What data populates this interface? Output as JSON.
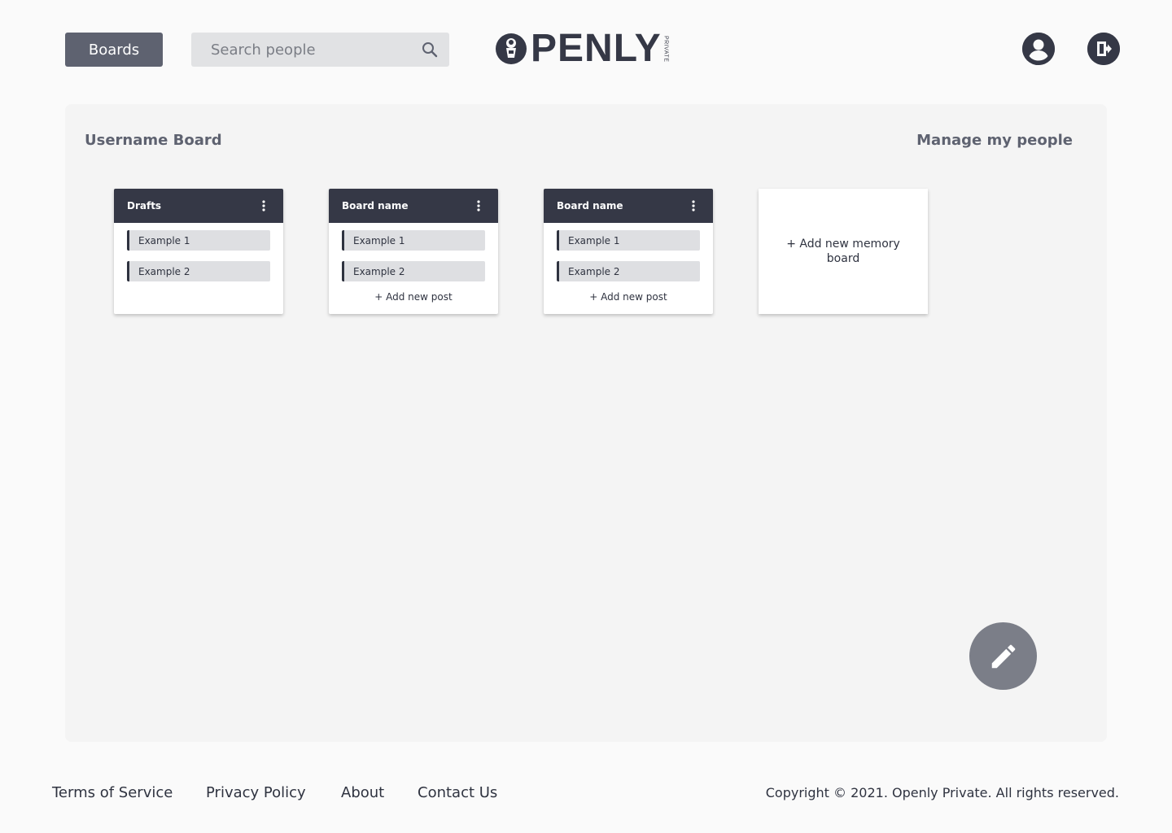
{
  "header": {
    "boards_label": "Boards",
    "search_placeholder": "Search people",
    "logo_text": "PENLY",
    "logo_sub": "PRIVATE",
    "icons": {
      "search": "search-icon",
      "profile": "account-circle-icon",
      "logout": "logout-icon"
    }
  },
  "board": {
    "title": "Username Board",
    "manage_label": "Manage my people",
    "cards": [
      {
        "title": "Drafts",
        "posts": [
          "Example 1",
          "Example 2"
        ],
        "add_label": ""
      },
      {
        "title": "Board name",
        "posts": [
          "Example 1",
          "Example 2"
        ],
        "add_label": "+ Add new post"
      },
      {
        "title": "Board name",
        "posts": [
          "Example 1",
          "Example 2"
        ],
        "add_label": "+ Add new post"
      }
    ],
    "add_board_label": "+ Add new memory board"
  },
  "footer": {
    "links": [
      "Terms of Service",
      "Privacy Policy",
      "About",
      "Contact Us"
    ],
    "copyright": "Copyright © 2021. Openly Private. All rights reserved."
  },
  "colors": {
    "accent_dark": "#353846",
    "button_gray": "#5e6270",
    "fab_gray": "#7b7e88",
    "board_bg": "#f4f4f4"
  }
}
